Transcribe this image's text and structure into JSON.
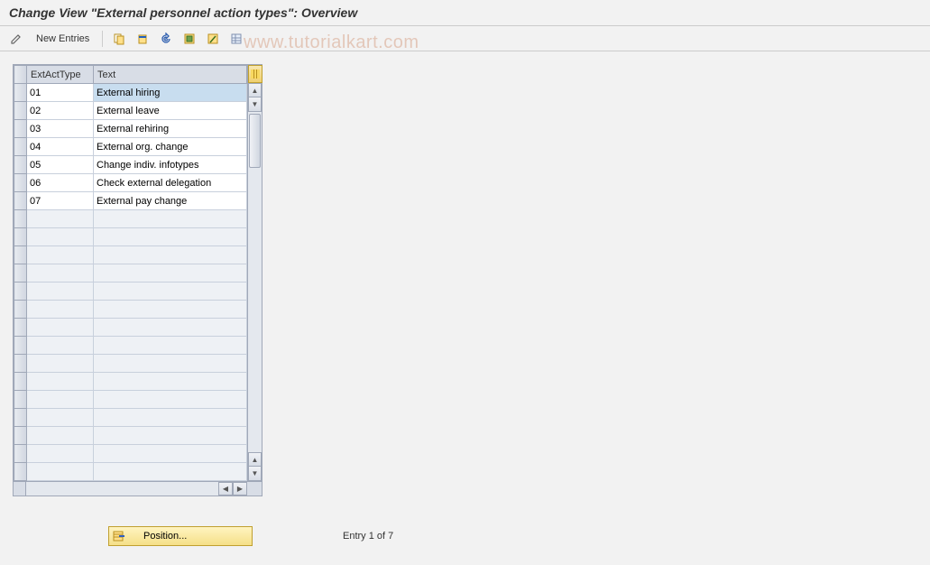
{
  "title": "Change View \"External personnel action types\": Overview",
  "toolbar": {
    "new_entries": "New Entries"
  },
  "watermark": "www.tutorialkart.com",
  "table": {
    "headers": {
      "ext": "ExtActType",
      "text": "Text"
    },
    "rows": [
      {
        "ext": "01",
        "text": "External hiring",
        "selected": true
      },
      {
        "ext": "02",
        "text": "External leave"
      },
      {
        "ext": "03",
        "text": "External rehiring"
      },
      {
        "ext": "04",
        "text": "External org. change"
      },
      {
        "ext": "05",
        "text": "Change indiv. infotypes"
      },
      {
        "ext": "06",
        "text": "Check external delegation"
      },
      {
        "ext": "07",
        "text": "External pay change"
      }
    ],
    "visible_rows": 22
  },
  "footer": {
    "position_btn": "Position...",
    "entry_info": "Entry 1 of 7"
  }
}
